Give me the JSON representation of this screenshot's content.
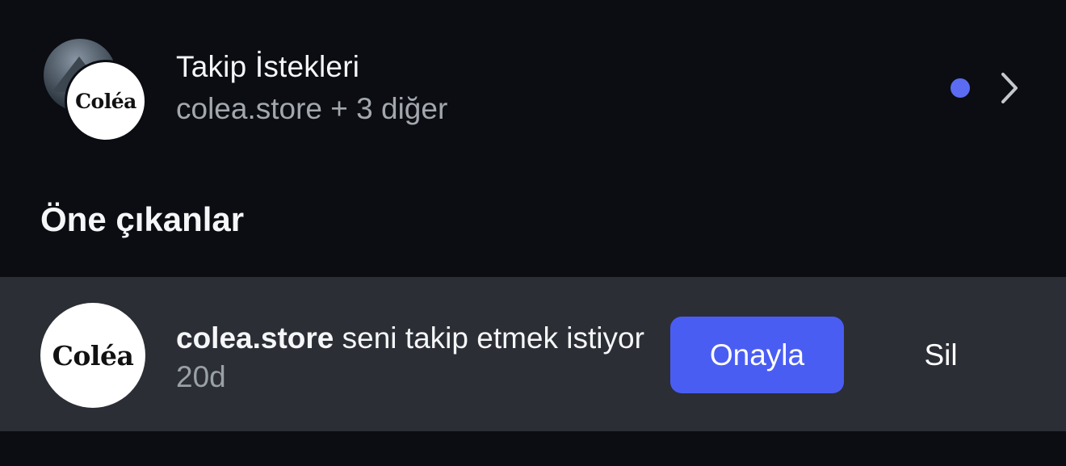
{
  "follow_requests": {
    "title": "Takip İstekleri",
    "subtitle": "colea.store + 3 diğer",
    "avatar_logo": "Coléa",
    "unread_indicator_color": "#5b6cf2",
    "chevron_icon": "chevron-right-icon"
  },
  "highlights": {
    "title": "Öne çıkanlar",
    "request": {
      "avatar_logo": "Coléa",
      "username": "colea.store",
      "message": " seni takip etmek istiyor ",
      "time": "20d",
      "approve_label": "Onayla",
      "delete_label": "Sil",
      "approve_color": "#4a5df3"
    }
  }
}
